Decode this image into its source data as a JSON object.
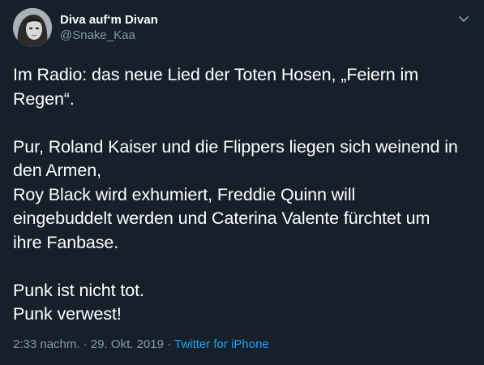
{
  "user": {
    "display_name": "Diva auf‘m Divan",
    "handle": "@Snake_Kaa"
  },
  "tweet": {
    "lines": [
      "Im Radio: das neue Lied der Toten Hosen, „Feiern im",
      "Regen“.",
      "",
      "Pur, Roland Kaiser und die Flippers liegen sich weinend in",
      "den Armen,",
      "Roy Black wird exhumiert, Freddie Quinn will",
      "eingebuddelt werden und Caterina Valente fürchtet um",
      "ihre Fanbase.",
      "",
      "Punk ist nicht tot.",
      "Punk verwest!"
    ]
  },
  "meta": {
    "time": "2:33 nachm.",
    "separator": " · ",
    "date": "29. Okt. 2019",
    "source": "Twitter for iPhone"
  },
  "icons": {
    "menu": "chevron-down-icon",
    "avatar": "profile-photo"
  },
  "colors": {
    "background": "#15202b",
    "text": "#ffffff",
    "secondary": "#8899a6",
    "link": "#1da1f2"
  }
}
